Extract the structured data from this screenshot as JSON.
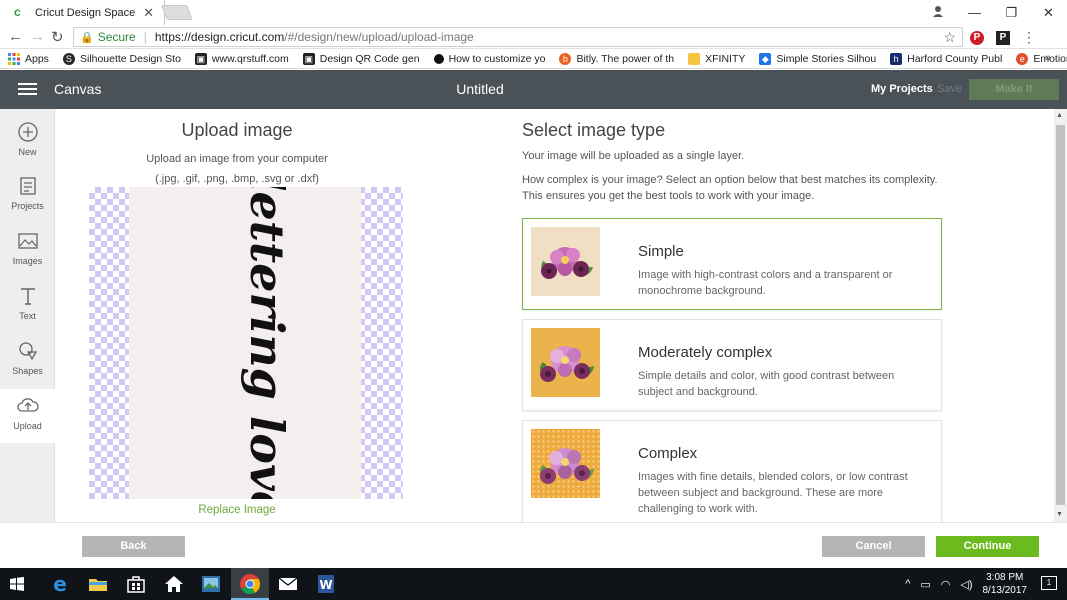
{
  "browser": {
    "tab_title": "Cricut Design Space",
    "address": {
      "secure_label": "Secure",
      "url_host": "https://design.cricut.com",
      "url_path": "/#/design/new/upload/upload-image"
    },
    "bookmarks": [
      {
        "label": "Apps",
        "icon": "apps-grid-icon",
        "color": "#4285f4"
      },
      {
        "label": "Silhouette Design Sto",
        "icon": "silhouette-icon",
        "color": "#2a2a2a"
      },
      {
        "label": "www.qrstuff.com",
        "icon": "qr-icon",
        "color": "#222222"
      },
      {
        "label": "Design QR Code gen",
        "icon": "qr-icon",
        "color": "#222222"
      },
      {
        "label": "How to customize yo",
        "icon": "dot-icon",
        "color": "#111111"
      },
      {
        "label": "Bitly. The power of th",
        "icon": "bitly-icon",
        "color": "#ee6123"
      },
      {
        "label": "XFINITY",
        "icon": "folder-icon",
        "color": "#f5c542"
      },
      {
        "label": "Simple Stories Silhou",
        "icon": "dropbox-icon",
        "color": "#1f74e8"
      },
      {
        "label": "Harford County Publ",
        "icon": "library-icon",
        "color": "#1b2a6b"
      },
      {
        "label": "Emotional Writing BS",
        "icon": "emotional-icon",
        "color": "#e0522b"
      }
    ],
    "bookmarks_more": "»"
  },
  "header": {
    "title": "Canvas",
    "project_name": "Untitled",
    "my_projects": "My Projects",
    "save": "Save",
    "make_it": "Make It"
  },
  "sidebar": {
    "items": [
      {
        "label": "New",
        "icon": "plus-circle-icon"
      },
      {
        "label": "Projects",
        "icon": "projects-icon"
      },
      {
        "label": "Images",
        "icon": "images-icon"
      },
      {
        "label": "Text",
        "icon": "text-icon"
      },
      {
        "label": "Shapes",
        "icon": "shapes-icon"
      },
      {
        "label": "Upload",
        "icon": "upload-cloud-icon"
      }
    ]
  },
  "upload": {
    "title": "Upload image",
    "subtitle_line1": "Upload an image from your computer",
    "subtitle_line2": "(.jpg, .gif, .png, .bmp, .svg or .dxf)",
    "preview_text": "lettering love",
    "replace_link": "Replace Image"
  },
  "select": {
    "title": "Select image type",
    "line1": "Your image will be uploaded as a single layer.",
    "line2": "How complex is your image? Select an option below that best matches its complexity. This ensures you get the best tools to work with your image.",
    "options": [
      {
        "title": "Simple",
        "desc": "Image with high-contrast colors and a transparent or monochrome background.",
        "selected": true
      },
      {
        "title": "Moderately complex",
        "desc": "Simple details and color, with good contrast between subject and background.",
        "selected": false
      },
      {
        "title": "Complex",
        "desc": "Images with fine details, blended colors, or low contrast between subject and background. These are more challenging to work with.",
        "selected": false
      }
    ]
  },
  "footer": {
    "back": "Back",
    "cancel": "Cancel",
    "continue": "Continue"
  },
  "taskbar": {
    "time": "3:08 PM",
    "date": "8/13/2017",
    "notification_count": "1"
  },
  "colors": {
    "accent_green": "#6bbb1f",
    "header_bg": "#4a5157",
    "selected_border": "#7bb63f"
  }
}
